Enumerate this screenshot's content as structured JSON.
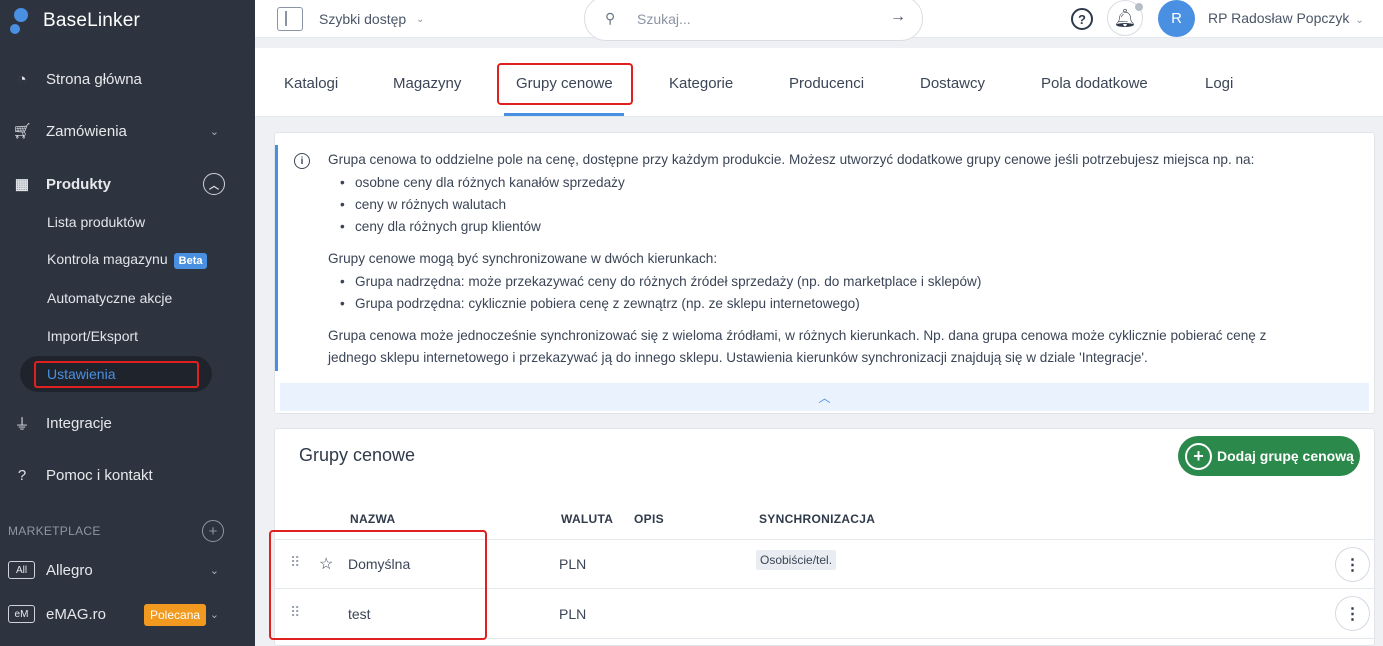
{
  "app": {
    "name": "BaseLinker"
  },
  "sidebar": {
    "items": [
      {
        "label": "Strona główna",
        "icon": "speedometer-icon"
      },
      {
        "label": "Zamówienia",
        "icon": "cart-icon"
      },
      {
        "label": "Produkty",
        "icon": "products-icon"
      },
      {
        "label": "Integracje",
        "icon": "plug-icon"
      },
      {
        "label": "Pomoc i kontakt",
        "icon": "help-circle-icon"
      }
    ],
    "sub_items": [
      {
        "label": "Lista produktów"
      },
      {
        "label": "Kontrola magazynu",
        "badge": "Beta"
      },
      {
        "label": "Automatyczne akcje"
      },
      {
        "label": "Import/Eksport"
      },
      {
        "label": "Ustawienia",
        "active": true
      }
    ],
    "marketplace_label": "MARKETPLACE",
    "marketplaces": [
      {
        "badge": "All",
        "label": "Allegro"
      },
      {
        "badge": "eM",
        "label": "eMAG.ro",
        "tag": "Polecana"
      }
    ]
  },
  "topbar": {
    "quick_access": "Szybki dostęp",
    "search_placeholder": "Szukaj...",
    "user_initial": "R",
    "user_name": "RP Radosław Popczyk"
  },
  "tabs": [
    {
      "label": "Katalogi"
    },
    {
      "label": "Magazyny"
    },
    {
      "label": "Grupy cenowe",
      "active": true
    },
    {
      "label": "Kategorie"
    },
    {
      "label": "Producenci"
    },
    {
      "label": "Dostawcy"
    },
    {
      "label": "Pola dodatkowe"
    },
    {
      "label": "Logi"
    }
  ],
  "info": {
    "intro": "Grupa cenowa to oddzielne pole na cenę, dostępne przy każdym produkcie. Możesz utworzyć dodatkowe grupy cenowe jeśli potrzebujesz miejsca np. na:",
    "list1": [
      "osobne ceny dla różnych kanałów sprzedaży",
      "ceny w różnych walutach",
      "ceny dla różnych grup klientów"
    ],
    "sync_intro": "Grupy cenowe mogą być synchronizowane w dwóch kierunkach:",
    "list2": [
      "Grupa nadrzędna: może przekazywać ceny do różnych źródeł sprzedaży (np. do marketplace i sklepów)",
      "Grupa podrzędna: cyklicznie pobiera cenę z zewnątrz (np. ze sklepu internetowego)"
    ],
    "outro_line1": "Grupa cenowa może jednocześnie synchronizować się z wieloma źródłami, w różnych kierunkach. Np. dana grupa cenowa może cyklicznie pobierać cenę z",
    "outro_line2": "jednego sklepu internetowego i przekazywać ją do innego sklepu. Ustawienia kierunków synchronizacji znajdują się w dziale 'Integracje'."
  },
  "groups": {
    "title": "Grupy cenowe",
    "add_button": "Dodaj grupę cenową",
    "columns": {
      "name": "NAZWA",
      "currency": "WALUTA",
      "description": "OPIS",
      "sync": "SYNCHRONIZACJA"
    },
    "rows": [
      {
        "name": "Domyślna",
        "currency": "PLN",
        "description": "",
        "sync": "Osobiście/tel.",
        "default": true
      },
      {
        "name": "test",
        "currency": "PLN",
        "description": "",
        "sync": ""
      }
    ]
  }
}
